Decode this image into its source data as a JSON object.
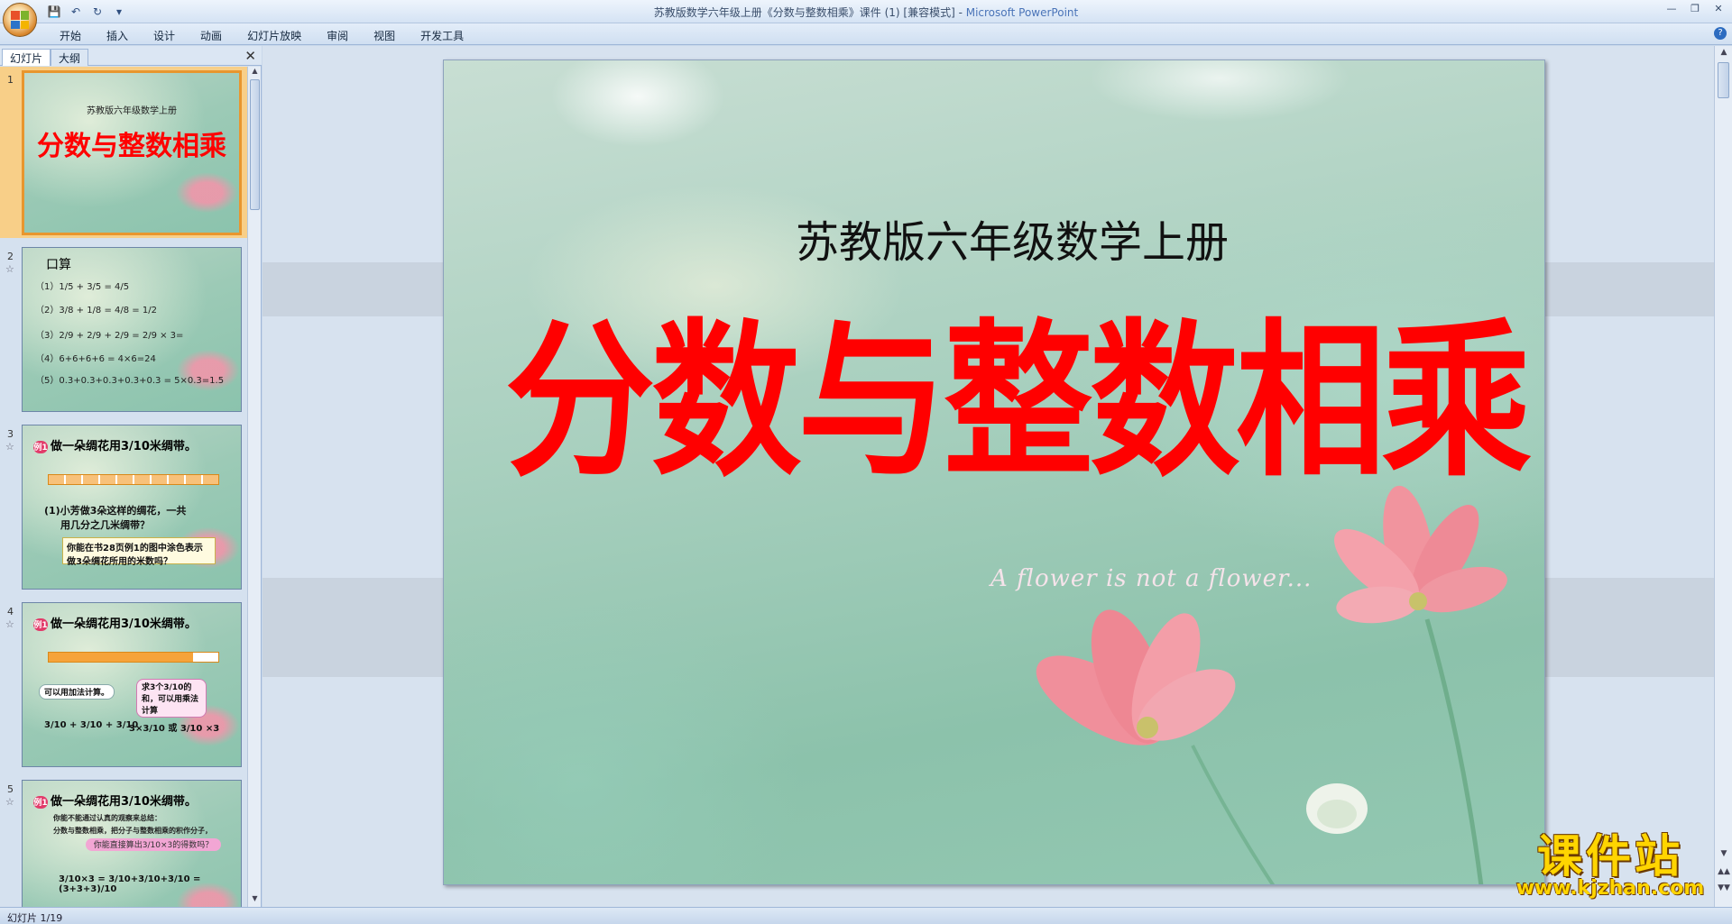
{
  "window": {
    "title": "苏教版数学六年级上册《分数与整数相乘》课件 (1) [兼容模式] - ",
    "app": "Microsoft PowerPoint"
  },
  "ribbon": {
    "tabs": [
      "开始",
      "插入",
      "设计",
      "动画",
      "幻灯片放映",
      "审阅",
      "视图",
      "开发工具"
    ]
  },
  "left_pane": {
    "tabs": [
      "幻灯片",
      "大纲"
    ],
    "thumbnails": [
      {
        "number": "1",
        "subtitle": "苏教版六年级数学上册",
        "title": "分数与整数相乘"
      },
      {
        "number": "2",
        "heading": "口算",
        "lines": [
          "（1）1/5 + 3/5 = 4/5",
          "（2）3/8 + 1/8 = 4/8 = 1/2",
          "（3）2/9 + 2/9 + 2/9 = 2/9 × 3=",
          "（4）6+6+6+6 = 4×6=24",
          "（5）0.3+0.3+0.3+0.3+0.3 = 5×0.3=1.5"
        ]
      },
      {
        "number": "3",
        "question": "做一朵绸花用3/10米绸带。",
        "badge": "例1",
        "text1": "(1)小芳做3朵这样的绸花，一共",
        "text2": "用几分之几米绸带？",
        "callout": "你能在书28页例1的图中涂色表示做3朵绸花所用的米数吗？"
      },
      {
        "number": "4",
        "question": "做一朵绸花用3/10米绸带。",
        "badge": "例1",
        "tag1": "可以用加法计算。",
        "tag2": "求3个3/10的和，可以用乘法计算",
        "formula1": "3/10 + 3/10 + 3/10",
        "formula2": "3×3/10 或 3/10 ×3"
      },
      {
        "number": "5",
        "question": "做一朵绸花用3/10米绸带。",
        "badge": "例1",
        "note": "你能不能通过认真的观察来总结：",
        "note2": "分数与整数相乘，把分子与整数相乘的积作分子，",
        "ribbon": "你能直接算出3/10×3的得数吗？",
        "formula": "3/10×3 = 3/10+3/10+3/10 = (3+3+3)/10"
      }
    ]
  },
  "slide": {
    "subtitle": "苏教版六年级数学上册",
    "title": "分数与整数相乘",
    "script": "A flower is not a flower..."
  },
  "watermark": {
    "name": "课件站",
    "url": "www.kjzhan.com"
  },
  "status": {
    "slide_info": "幻灯片 1/19"
  },
  "colors": {
    "title_red": "#ff0000",
    "selected_thumb": "#f8cf88",
    "watermark_yellow": "#ffd500"
  }
}
